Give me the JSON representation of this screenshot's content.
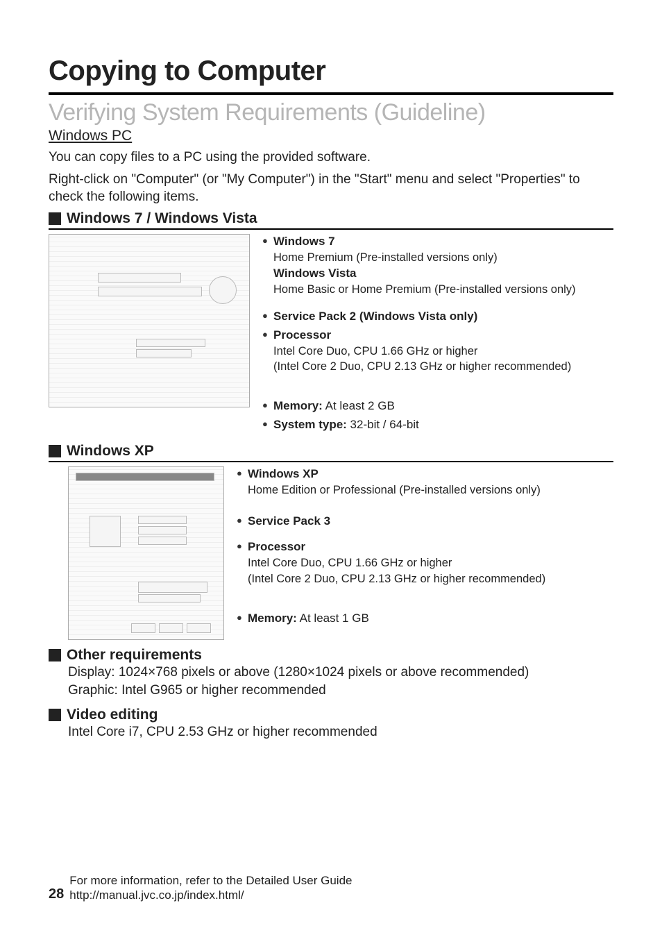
{
  "title": "Copying to Computer",
  "subtitle": "Verifying System Requirements (Guideline)",
  "platform_heading": "Windows PC",
  "intro_l1": "You can copy files to a PC using the provided software.",
  "intro_l2": "Right-click on \"Computer\" (or \"My Computer\") in the \"Start\" menu and select \"Properties\" to check the following items.",
  "sec1_title": "Windows 7 / Windows Vista",
  "win7": {
    "label": "Windows 7",
    "desc": "Home Premium (Pre-installed versions only)"
  },
  "vista": {
    "label": "Windows Vista",
    "desc": "Home Basic or Home Premium (Pre-installed versions only)"
  },
  "sp2": "Service Pack 2 (Windows Vista only)",
  "proc": {
    "label": "Processor",
    "l1": "Intel Core Duo, CPU 1.66 GHz or higher",
    "l2": "(Intel Core 2 Duo, CPU 2.13 GHz or higher recommended)"
  },
  "mem7": {
    "label": "Memory:",
    "val": " At least 2 GB"
  },
  "systype": {
    "label": "System type:",
    "val": " 32-bit / 64-bit"
  },
  "sec2_title": "Windows XP",
  "xp": {
    "label": "Windows XP",
    "desc": "Home Edition or Professional (Pre-installed versions only)"
  },
  "sp3": "Service Pack 3",
  "procxp": {
    "label": "Processor",
    "l1": "Intel Core Duo, CPU 1.66 GHz or higher",
    "l2": "(Intel Core 2 Duo, CPU 2.13 GHz or higher recommended)"
  },
  "memxp": {
    "label": "Memory:",
    "val": " At least 1 GB"
  },
  "sec3_title": "Other requirements",
  "other_l1": "Display: 1024×768 pixels or above (1280×1024 pixels or above recommended)",
  "other_l2": "Graphic: Intel G965 or higher recommended",
  "sec4_title": "Video editing",
  "video_l1": "Intel Core i7, CPU 2.53 GHz or higher recommended",
  "page_number": "28",
  "footer_l1": "For more information, refer to the Detailed User Guide",
  "footer_l2": "http://manual.jvc.co.jp/index.html/"
}
